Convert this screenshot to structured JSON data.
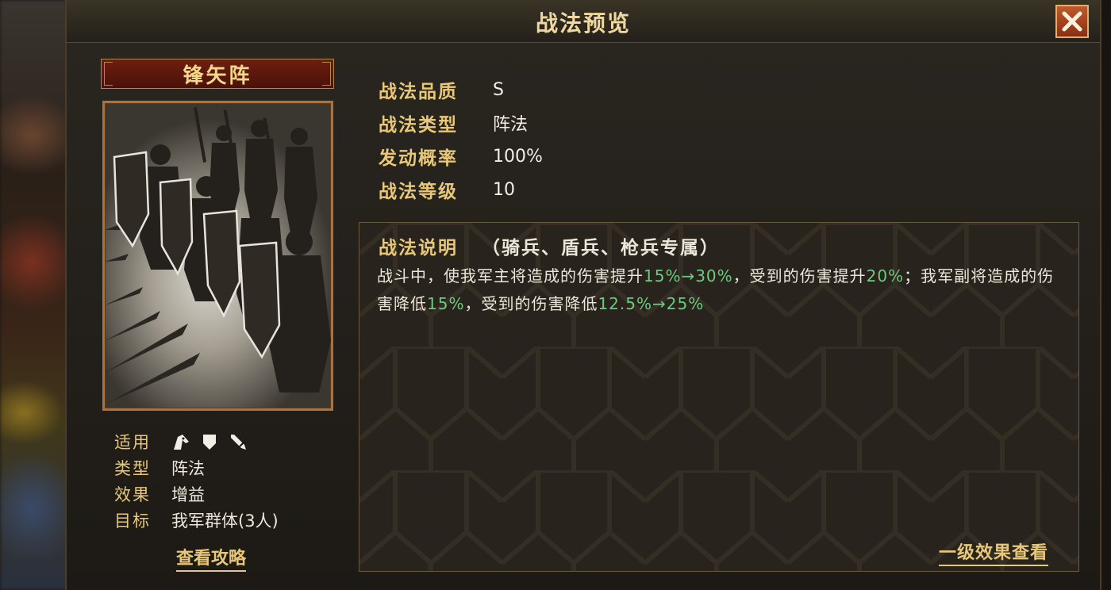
{
  "dialog": {
    "title": "战法预览"
  },
  "skill": {
    "name": "锋矢阵",
    "info": {
      "applicable_label": "适用",
      "applicable_icons": [
        "cavalry-icon",
        "shield-icon",
        "spear-icon"
      ],
      "type_label": "类型",
      "type_value": "阵法",
      "effect_label": "效果",
      "effect_value": "增益",
      "target_label": "目标",
      "target_value": "我军群体(3人)"
    },
    "guide_link": "查看攻略"
  },
  "stats": {
    "quality_label": "战法品质",
    "quality_value": "S",
    "category_label": "战法类型",
    "category_value": "阵法",
    "rate_label": "发动概率",
    "rate_value": "100%",
    "level_label": "战法等级",
    "level_value": "10"
  },
  "description": {
    "title": "战法说明",
    "scope": "（骑兵、盾兵、枪兵专属）",
    "parts": {
      "p1": "战斗中，使我军主将造成的伤害提升",
      "h1": "15%→30%",
      "p2": "，受到的伤害提升",
      "h2": "20%",
      "p3": "；我军副将造成的伤害降低",
      "h3": "15%",
      "p4": "，受到的伤害降低",
      "h4": "12.5%→25%"
    },
    "effect_link": "一级效果查看"
  },
  "colors": {
    "gold": "#e8c878",
    "highlight_green": "#6ccb7e",
    "name_plate_red": "#6e1e10"
  }
}
